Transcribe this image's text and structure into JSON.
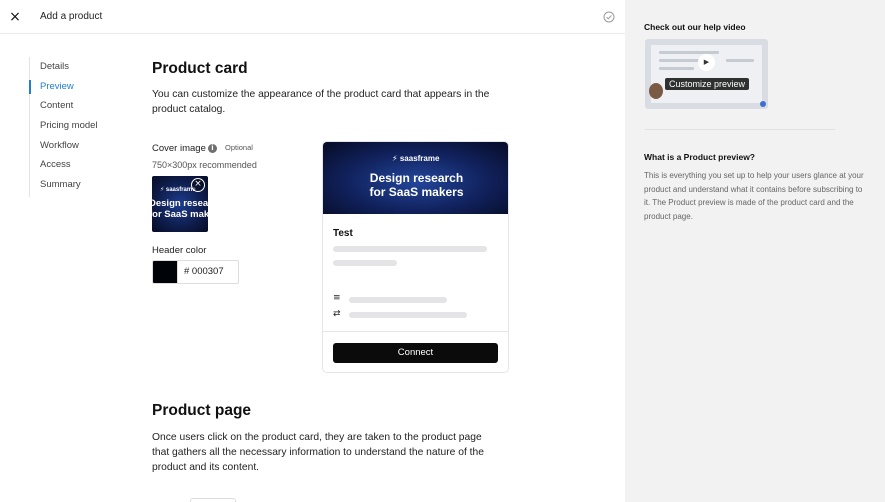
{
  "topbar": {
    "close_icon": "×",
    "title": "Add a product",
    "status_icon": "check-circle-icon"
  },
  "nav": {
    "active_index": 1,
    "items": [
      {
        "label": "Details"
      },
      {
        "label": "Preview"
      },
      {
        "label": "Content"
      },
      {
        "label": "Pricing model"
      },
      {
        "label": "Workflow"
      },
      {
        "label": "Access"
      },
      {
        "label": "Summary"
      }
    ]
  },
  "product_card": {
    "heading": "Product card",
    "description_line1": "You can customize the appearance of the product card that appears in the",
    "description_line2": "product catalog.",
    "cover_image": {
      "label": "Cover image",
      "info_icon": "i",
      "optional": "Optional",
      "hint": "750×300px recommended",
      "thumb_logo": "⚡ saasframe",
      "thumb_line1": "Design researc",
      "thumb_line2": "for SaaS maker",
      "remove_icon": "×"
    },
    "header_color": {
      "label": "Header color",
      "value": "# 000307",
      "swatch_color": "#000307"
    },
    "preview": {
      "banner_logo": "⚡ saasframe",
      "banner_line1": "Design research",
      "banner_line2": "for SaaS makers",
      "title": "Test",
      "list_icon": "≡",
      "swap_icon": "⇄",
      "connect_label": "Connect"
    }
  },
  "product_page": {
    "heading": "Product page",
    "description_line1": "Once users click on the product card, they are taken to the product page",
    "description_line2": "that gathers all the necessary information to understand the nature of the",
    "description_line3": "product and its content."
  },
  "help": {
    "video_heading": "Check out our help video",
    "video_caption": "Customize preview",
    "play_icon": "▶",
    "section_heading": "What is a Product preview?",
    "section_text": "This is everything you set up to help your users glance at your product and understand what it contains before subscribing to it. The Product preview is made of the product card and the product page."
  },
  "colors": {
    "accent": "#1f7fd6",
    "button": "#0b0b0b",
    "panel": "#f2f2f2"
  }
}
